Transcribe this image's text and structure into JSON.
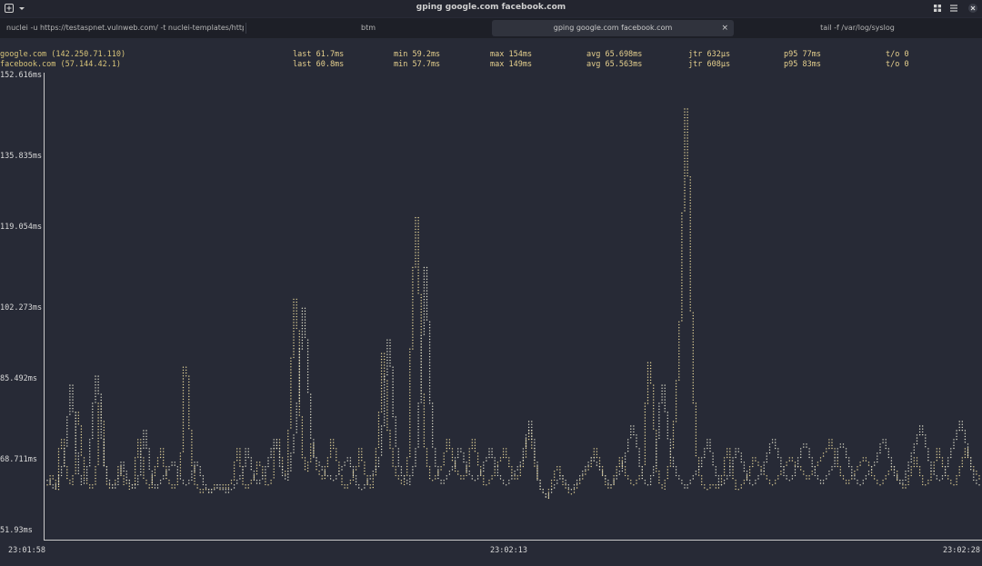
{
  "window": {
    "title": "gping google.com facebook.com",
    "icons": [
      "new-tab-icon",
      "dropdown-icon",
      "grid-icon",
      "menu-icon",
      "close-icon"
    ]
  },
  "tabs": [
    {
      "label": "nuclei -u https://testaspnet.vulnweb.com/ -t nuclei-templates/http",
      "active": false
    },
    {
      "label": "btm",
      "active": false
    },
    {
      "label": "gping google.com facebook.com",
      "active": true,
      "close": "×"
    },
    {
      "label": "tail -f /var/log/syslog",
      "active": false
    }
  ],
  "hosts": [
    {
      "host": "google.com (142.250.71.110)",
      "last": "last 61.7ms",
      "min": "min 59.2ms",
      "max": "max 154ms",
      "avg": "avg 65.698ms",
      "jtr": "jtr 632µs",
      "p95": "p95 77ms",
      "to": "t/o 0"
    },
    {
      "host": "facebook.com (57.144.42.1)",
      "last": "last 60.8ms",
      "min": "min 57.7ms",
      "max": "max 149ms",
      "avg": "avg 65.563ms",
      "jtr": "jtr 608µs",
      "p95": "p95 83ms",
      "to": "t/o 0"
    }
  ],
  "y_ticks": [
    "152.616ms",
    "135.835ms",
    "119.054ms",
    "102.273ms",
    "85.492ms",
    "68.711ms",
    "51.93ms"
  ],
  "x_ticks": [
    "23:01:58",
    "23:02:13",
    "23:02:28"
  ],
  "colors": {
    "background": "#272a36",
    "series1": "#e8d79a",
    "series2": "#e3e2cf",
    "axis": "#c9c9c9"
  },
  "chart_data": {
    "type": "scatter",
    "ylim": [
      51.93,
      152.616
    ],
    "x_ticks": [
      "23:01:58",
      "23:02:13",
      "23:02:28"
    ],
    "y_ticks": [
      51.93,
      68.711,
      85.492,
      102.273,
      119.054,
      135.835,
      152.616
    ],
    "series": [
      {
        "name": "google.com (142.250.71.110)",
        "values": [
          62,
          64,
          63,
          61,
          70,
          72,
          66,
          63,
          62,
          64,
          78,
          75,
          68,
          63,
          62,
          61,
          62,
          66,
          80,
          76,
          66,
          62,
          61,
          62,
          63,
          66,
          64,
          62,
          63,
          61,
          62,
          68,
          72,
          68,
          63,
          62,
          61,
          64,
          66,
          68,
          70,
          66,
          63,
          62,
          61,
          62,
          64,
          69,
          88,
          86,
          74,
          66,
          62,
          61,
          60,
          61,
          61,
          60,
          61,
          62,
          61,
          61,
          62,
          61,
          62,
          63,
          67,
          70,
          66,
          62,
          61,
          62,
          63,
          64,
          67,
          66,
          64,
          62,
          62,
          63,
          70,
          72,
          68,
          65,
          64,
          74,
          90,
          103,
          96,
          77,
          68,
          65,
          67,
          71,
          68,
          65,
          64,
          63,
          66,
          68,
          72,
          70,
          67,
          64,
          62,
          61,
          62,
          63,
          65,
          66,
          70,
          67,
          64,
          62,
          61,
          64,
          70,
          78,
          91,
          85,
          74,
          70,
          66,
          64,
          63,
          62,
          64,
          68,
          92,
          110,
          121,
          104,
          82,
          70,
          66,
          63,
          63,
          64,
          65,
          66,
          69,
          72,
          70,
          67,
          65,
          64,
          63,
          64,
          66,
          70,
          72,
          69,
          66,
          64,
          62,
          62,
          63,
          64,
          66,
          67,
          68,
          70,
          68,
          66,
          64,
          63,
          64,
          66,
          68,
          72,
          74,
          70,
          66,
          63,
          61,
          60,
          59,
          61,
          63,
          65,
          66,
          64,
          62,
          61,
          60,
          60,
          61,
          62,
          63,
          64,
          65,
          66,
          68,
          70,
          68,
          66,
          64,
          62,
          61,
          62,
          64,
          66,
          68,
          66,
          64,
          63,
          62,
          62,
          63,
          64,
          66,
          80,
          89,
          84,
          74,
          65,
          62,
          61,
          63,
          66,
          70,
          76,
          85,
          98,
          122,
          145,
          130,
          100,
          80,
          68,
          64,
          62,
          61,
          61,
          62,
          62,
          61,
          62,
          64,
          68,
          70,
          66,
          63,
          61,
          61,
          62,
          63,
          64,
          66,
          68,
          67,
          66,
          65,
          64,
          63,
          62,
          62,
          63,
          64,
          65,
          66,
          67,
          68,
          67,
          66,
          66,
          65,
          64,
          63,
          64,
          65,
          66,
          67,
          68,
          69,
          70,
          72,
          70,
          68,
          66,
          64,
          63,
          62,
          63,
          64,
          65,
          66,
          67,
          68,
          67,
          66,
          64,
          63,
          62,
          62,
          63,
          64,
          65,
          66,
          65,
          63,
          62,
          61,
          62,
          64,
          66,
          68,
          66,
          64,
          62,
          62,
          63,
          65,
          67,
          70,
          68,
          66,
          64,
          63,
          62,
          62,
          64,
          66,
          68,
          70,
          68,
          66,
          65,
          64,
          63
        ]
      },
      {
        "name": "facebook.com (57.144.42.1)",
        "values": [
          63,
          62,
          61,
          62,
          64,
          66,
          70,
          77,
          84,
          78,
          69,
          64,
          62,
          63,
          66,
          72,
          80,
          86,
          82,
          72,
          66,
          63,
          62,
          61,
          62,
          64,
          67,
          65,
          63,
          62,
          61,
          62,
          64,
          70,
          74,
          70,
          65,
          62,
          61,
          62,
          63,
          64,
          65,
          66,
          67,
          66,
          64,
          63,
          62,
          62,
          63,
          65,
          67,
          66,
          64,
          62,
          61,
          60,
          61,
          61,
          62,
          61,
          61,
          60,
          61,
          61,
          62,
          63,
          64,
          66,
          70,
          68,
          65,
          63,
          62,
          63,
          64,
          66,
          68,
          70,
          72,
          70,
          66,
          64,
          63,
          65,
          69,
          73,
          80,
          92,
          101,
          94,
          82,
          72,
          68,
          67,
          66,
          65,
          64,
          64,
          63,
          63,
          64,
          65,
          66,
          67,
          68,
          66,
          64,
          62,
          61,
          61,
          62,
          63,
          64,
          65,
          66,
          68,
          75,
          86,
          94,
          88,
          77,
          70,
          66,
          64,
          63,
          62,
          64,
          66,
          70,
          80,
          95,
          110,
          98,
          80,
          70,
          66,
          63,
          62,
          63,
          64,
          65,
          66,
          68,
          70,
          69,
          67,
          65,
          64,
          63,
          63,
          64,
          65,
          67,
          68,
          70,
          68,
          66,
          64,
          63,
          62,
          62,
          63,
          64,
          65,
          66,
          67,
          70,
          73,
          76,
          72,
          67,
          63,
          61,
          60,
          59,
          60,
          61,
          62,
          63,
          64,
          63,
          62,
          61,
          61,
          62,
          63,
          64,
          65,
          66,
          67,
          68,
          67,
          66,
          65,
          64,
          63,
          62,
          62,
          63,
          64,
          65,
          67,
          69,
          72,
          75,
          73,
          70,
          66,
          63,
          62,
          62,
          64,
          66,
          72,
          80,
          84,
          78,
          72,
          68,
          66,
          64,
          63,
          62,
          61,
          62,
          63,
          64,
          65,
          66,
          68,
          70,
          72,
          69,
          66,
          64,
          62,
          62,
          63,
          64,
          66,
          68,
          70,
          69,
          67,
          65,
          63,
          62,
          62,
          63,
          64,
          65,
          67,
          69,
          71,
          72,
          70,
          68,
          66,
          64,
          63,
          63,
          64,
          66,
          68,
          70,
          71,
          70,
          68,
          66,
          64,
          63,
          62,
          63,
          64,
          65,
          66,
          68,
          70,
          71,
          70,
          68,
          66,
          64,
          63,
          62,
          62,
          63,
          64,
          65,
          66,
          67,
          69,
          71,
          72,
          70,
          68,
          66,
          64,
          63,
          62,
          63,
          65,
          67,
          69,
          71,
          73,
          75,
          73,
          70,
          67,
          65,
          64,
          63,
          63,
          64,
          66,
          68,
          70,
          72,
          74,
          76,
          74,
          71,
          68,
          65,
          63,
          62,
          62
        ]
      }
    ]
  }
}
